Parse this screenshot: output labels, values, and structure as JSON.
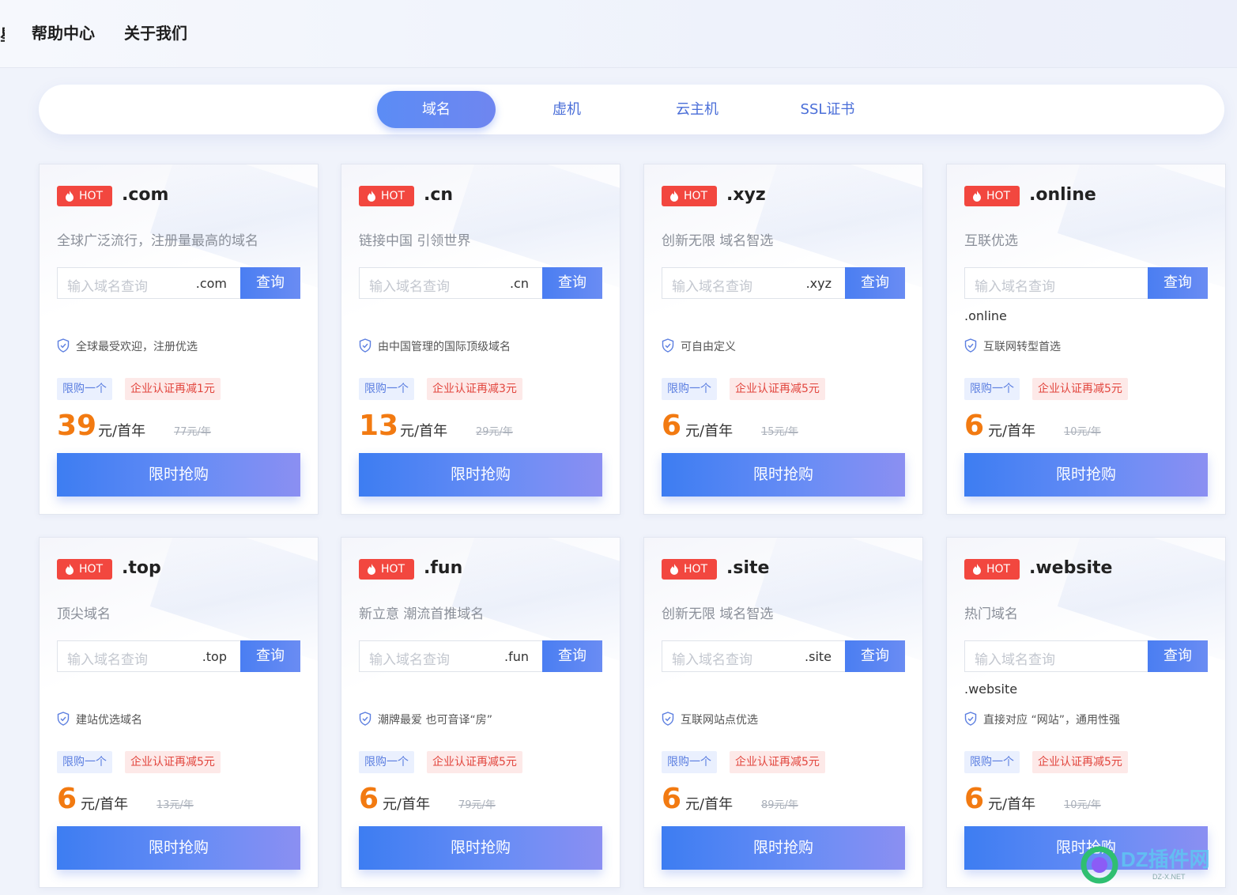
{
  "nav": {
    "cut_char": "星",
    "help": "帮助中心",
    "about": "关于我们"
  },
  "tabs": [
    {
      "label": "域名",
      "active": true
    },
    {
      "label": "虚机",
      "active": false
    },
    {
      "label": "云主机",
      "active": false
    },
    {
      "label": "SSL证书",
      "active": false
    }
  ],
  "common": {
    "hot": "HOT",
    "search_placeholder": "输入域名查询",
    "search_button": "查询",
    "limit_tag": "限购一个",
    "buy_button": "限时抢购",
    "unit": "元/首年"
  },
  "cards": [
    {
      "suffix": ".com",
      "desc": "全球广泛流行，注册量最高的域名",
      "feature": "全球最受欢迎，注册优选",
      "corp_tag": "企业认证再减1元",
      "price": "39",
      "original": "77元/年"
    },
    {
      "suffix": ".cn",
      "desc": "链接中国 引领世界",
      "feature": "由中国管理的国际顶级域名",
      "corp_tag": "企业认证再减3元",
      "price": "13",
      "original": "29元/年"
    },
    {
      "suffix": ".xyz",
      "desc": "创新无限 域名智选",
      "feature": "可自由定义",
      "corp_tag": "企业认证再减5元",
      "price": "6",
      "original": "15元/年"
    },
    {
      "suffix": ".online",
      "desc": "互联优选",
      "feature": "互联网转型首选",
      "corp_tag": "企业认证再减5元",
      "price": "6",
      "original": "10元/年"
    },
    {
      "suffix": ".top",
      "desc": "顶尖域名",
      "feature": "建站优选域名",
      "corp_tag": "企业认证再减5元",
      "price": "6",
      "original": "13元/年"
    },
    {
      "suffix": ".fun",
      "desc": "新立意 潮流首推域名",
      "feature": "潮牌最爱 也可音译“房”",
      "corp_tag": "企业认证再减5元",
      "price": "6",
      "original": "79元/年"
    },
    {
      "suffix": ".site",
      "desc": "创新无限 域名智选",
      "feature": "互联网站点优选",
      "corp_tag": "企业认证再减5元",
      "price": "6",
      "original": "89元/年"
    },
    {
      "suffix": ".website",
      "desc": "热门域名",
      "feature": "直接对应 “网站”，通用性强",
      "corp_tag": "企业认证再减5元",
      "price": "6",
      "original": "10元/年"
    }
  ],
  "watermark": {
    "text": "DZ插件网",
    "sub": "DZ-X.NET"
  }
}
